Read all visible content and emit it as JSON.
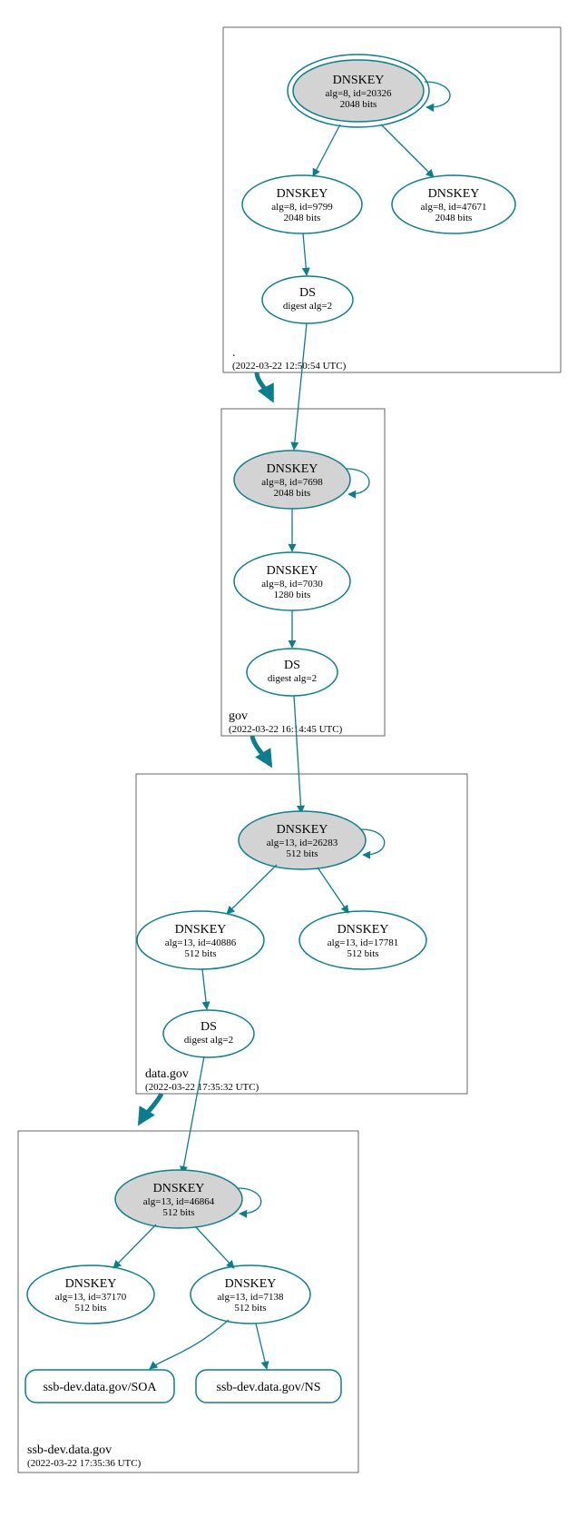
{
  "colors": {
    "teal": "#0a7e8c",
    "node_fill": "#d3d3d3"
  },
  "zones": {
    "root": {
      "label": ".",
      "timestamp": "(2022-03-22 12:50:54 UTC)"
    },
    "gov": {
      "label": "gov",
      "timestamp": "(2022-03-22 16:14:45 UTC)"
    },
    "data_gov": {
      "label": "data.gov",
      "timestamp": "(2022-03-22 17:35:32 UTC)"
    },
    "ssb_dev": {
      "label": "ssb-dev.data.gov",
      "timestamp": "(2022-03-22 17:35:36 UTC)"
    }
  },
  "nodes": {
    "root_ksk": {
      "title": "DNSKEY",
      "line2": "alg=8, id=20326",
      "line3": "2048 bits"
    },
    "root_zsk": {
      "title": "DNSKEY",
      "line2": "alg=8, id=9799",
      "line3": "2048 bits"
    },
    "root_extra": {
      "title": "DNSKEY",
      "line2": "alg=8, id=47671",
      "line3": "2048 bits"
    },
    "root_ds": {
      "title": "DS",
      "line2": "digest alg=2"
    },
    "gov_ksk": {
      "title": "DNSKEY",
      "line2": "alg=8, id=7698",
      "line3": "2048 bits"
    },
    "gov_zsk": {
      "title": "DNSKEY",
      "line2": "alg=8, id=7030",
      "line3": "1280 bits"
    },
    "gov_ds": {
      "title": "DS",
      "line2": "digest alg=2"
    },
    "dg_ksk": {
      "title": "DNSKEY",
      "line2": "alg=13, id=26283",
      "line3": "512 bits"
    },
    "dg_zsk": {
      "title": "DNSKEY",
      "line2": "alg=13, id=40886",
      "line3": "512 bits"
    },
    "dg_extra": {
      "title": "DNSKEY",
      "line2": "alg=13, id=17781",
      "line3": "512 bits"
    },
    "dg_ds": {
      "title": "DS",
      "line2": "digest alg=2"
    },
    "sd_ksk": {
      "title": "DNSKEY",
      "line2": "alg=13, id=46864",
      "line3": "512 bits"
    },
    "sd_zsk1": {
      "title": "DNSKEY",
      "line2": "alg=13, id=37170",
      "line3": "512 bits"
    },
    "sd_zsk2": {
      "title": "DNSKEY",
      "line2": "alg=13, id=7138",
      "line3": "512 bits"
    },
    "sd_soa": {
      "title": "ssb-dev.data.gov/SOA"
    },
    "sd_ns": {
      "title": "ssb-dev.data.gov/NS"
    }
  }
}
